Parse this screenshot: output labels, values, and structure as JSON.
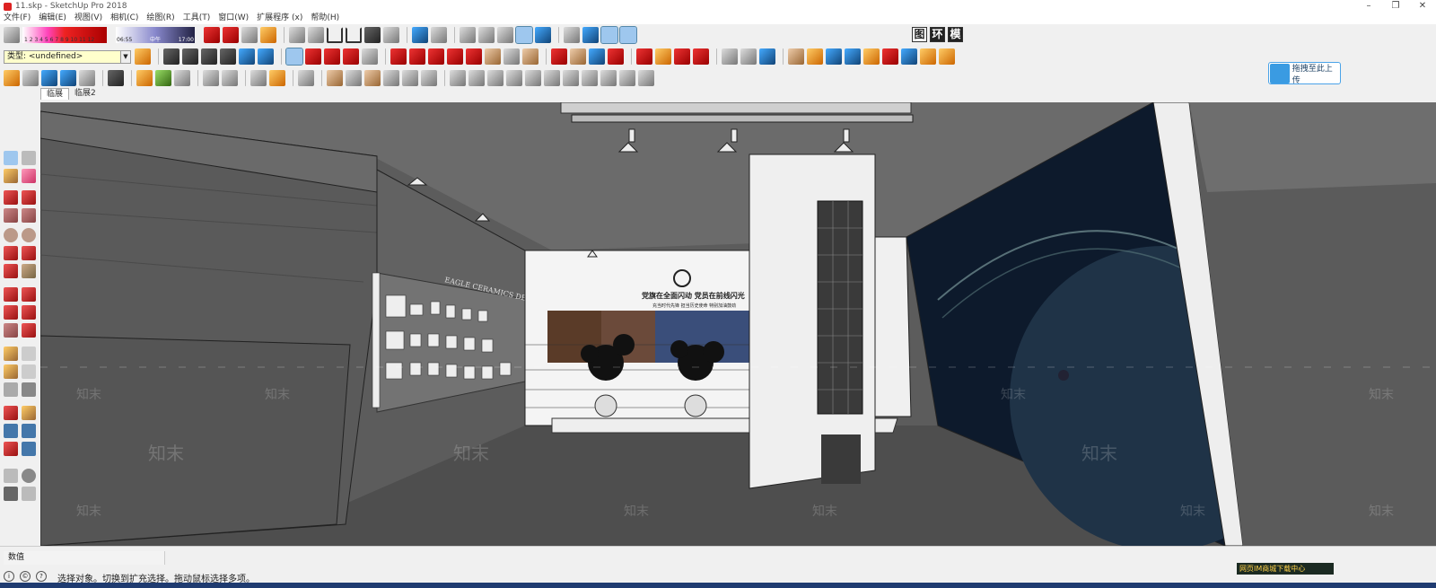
{
  "window": {
    "title": "11.skp - SketchUp Pro 2018",
    "controls": [
      "–",
      "❐",
      "✕"
    ]
  },
  "menu": [
    "文件(F)",
    "编辑(E)",
    "视图(V)",
    "相机(C)",
    "绘图(R)",
    "工具(T)",
    "窗口(W)",
    "扩展程序 (x)",
    "帮助(H)"
  ],
  "toolbar": {
    "shadow_scale": "1 2 3 4 5 6 7 8 9 10 11 12",
    "time_scale_left": "06:55",
    "time_scale_mid": "中午",
    "time_scale_right": "17:00",
    "layer_label": "类型: <undefined>",
    "cn_buttons": [
      "图",
      "环",
      "模"
    ],
    "upload_label": "拖拽至此上传"
  },
  "scene_tabs": [
    "临展",
    "临展2"
  ],
  "viewport": {
    "watermark_text": "知末",
    "wall_text_main": "党旗在全面闪动 党员在前线闪光",
    "wall_text_sub": "充当时代先锋 担当历史使命 特别加油鼓劲",
    "brand_text": "EAGLE CERAMICS DESIGNS"
  },
  "status": {
    "measure_label": "数值",
    "hint": "选择对象。切换到扩充选择。拖动鼠标选择多项。",
    "corner_text": "网页IM商城下载中心"
  },
  "colors": {
    "accent": "#3a9be2",
    "viewport_bg": "#5c5c5c"
  }
}
